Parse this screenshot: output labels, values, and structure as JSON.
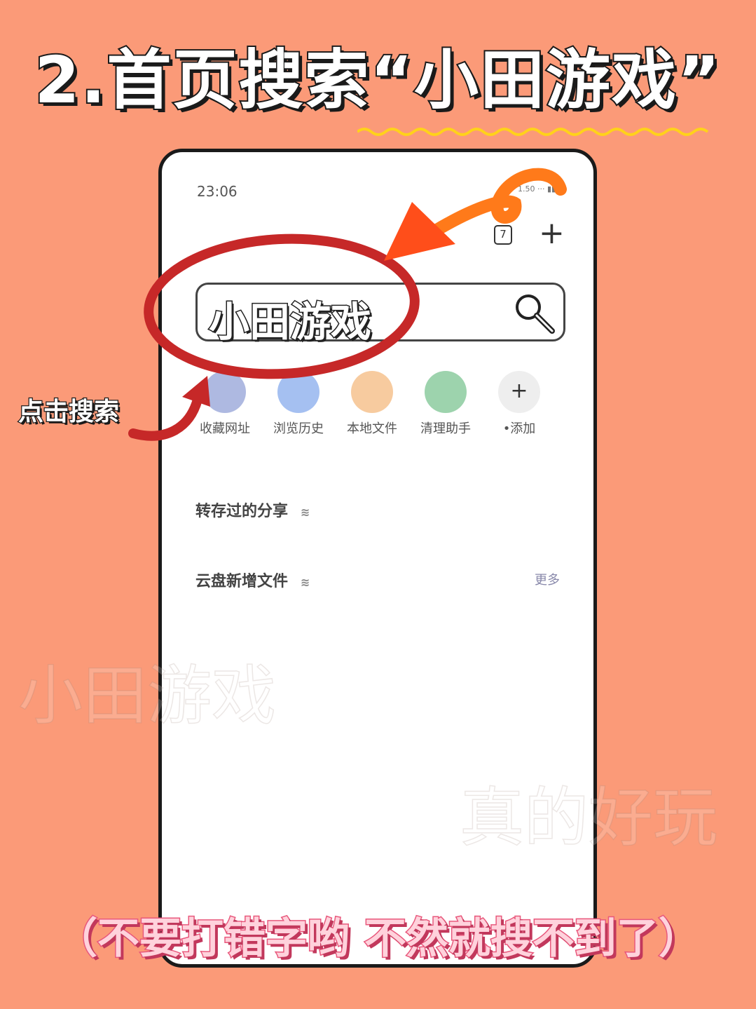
{
  "page": {
    "title": "2.首页搜索“小田游戏”",
    "side_label": "点击搜索",
    "bottom_note": "（不要打错字哟 不然就搜不到了）",
    "watermarks": [
      "小田游戏",
      "真的好玩"
    ]
  },
  "phone": {
    "status_time": "23:06",
    "status_extra": "1.50 ··· ▮▮ ▭",
    "tab_count": "7",
    "add_tab_icon": "+",
    "search": {
      "value": "小田游戏",
      "icon": "search-icon"
    },
    "shortcuts": [
      {
        "label": "收藏网址",
        "icon": "bookmark-icon",
        "color": "#6b7fc9"
      },
      {
        "label": "浏览历史",
        "icon": "history-icon",
        "color": "#5b8de6"
      },
      {
        "label": "本地文件",
        "icon": "folder-icon",
        "color": "#f0a050"
      },
      {
        "label": "清理助手",
        "icon": "broom-icon",
        "color": "#4caf6a"
      },
      {
        "label": "•添加",
        "icon": "plus-icon",
        "color": "#eeeeee"
      }
    ],
    "sections": [
      {
        "title": "转存过的分享",
        "sub": "≋"
      },
      {
        "title": "云盘新增文件",
        "sub": "≋",
        "more": "更多"
      }
    ]
  },
  "colors": {
    "background": "#fb9a78",
    "circle_annotation": "#c62828",
    "arrow_annotation": "#ff6a1a",
    "squiggle": "#ffd21a"
  }
}
